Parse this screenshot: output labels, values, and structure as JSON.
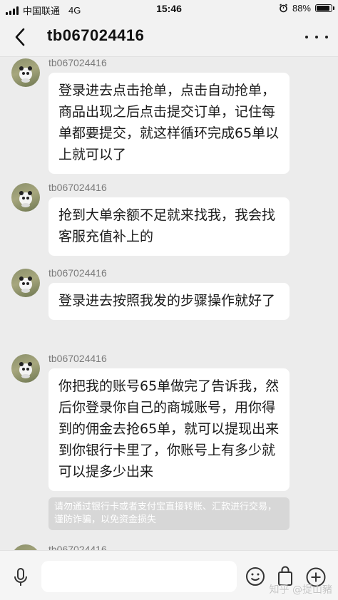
{
  "status_bar": {
    "carrier": "中国联通",
    "network": "4G",
    "time": "15:46",
    "battery_text": "88%",
    "battery_level": 0.88
  },
  "header": {
    "title": "tb067024416"
  },
  "messages": [
    {
      "sender": "tb067024416",
      "text": "登录进去点击抢单，点击自动抢单，商品出现之后点击提交订单，记住每单都要提交，就这样循环完成65单以上就可以了"
    },
    {
      "sender": "tb067024416",
      "text": "抢到大单余额不足就来找我，我会找客服充值补上的"
    },
    {
      "sender": "tb067024416",
      "text": "登录进去按照我发的步骤操作就好了"
    },
    {
      "sender": "tb067024416",
      "text": "你把我的账号65单做完了告诉我，然后你登录你自己的商城账号，用你得到的佣金去抢65单，就可以提现出来到你银行卡里了，你账号上有多少就可以提多少出来"
    },
    {
      "sender": "tb067024416",
      "text": ""
    }
  ],
  "notice": "请勿通过银行卡或者支付宝直接转账、汇款进行交易，谨防诈骗，以免资金损失",
  "input_bar": {
    "placeholder": "",
    "icons": [
      "microphone-icon",
      "emoji-icon",
      "shopping-bag-icon",
      "plus-icon"
    ]
  },
  "watermark": "知乎 @提山豬"
}
